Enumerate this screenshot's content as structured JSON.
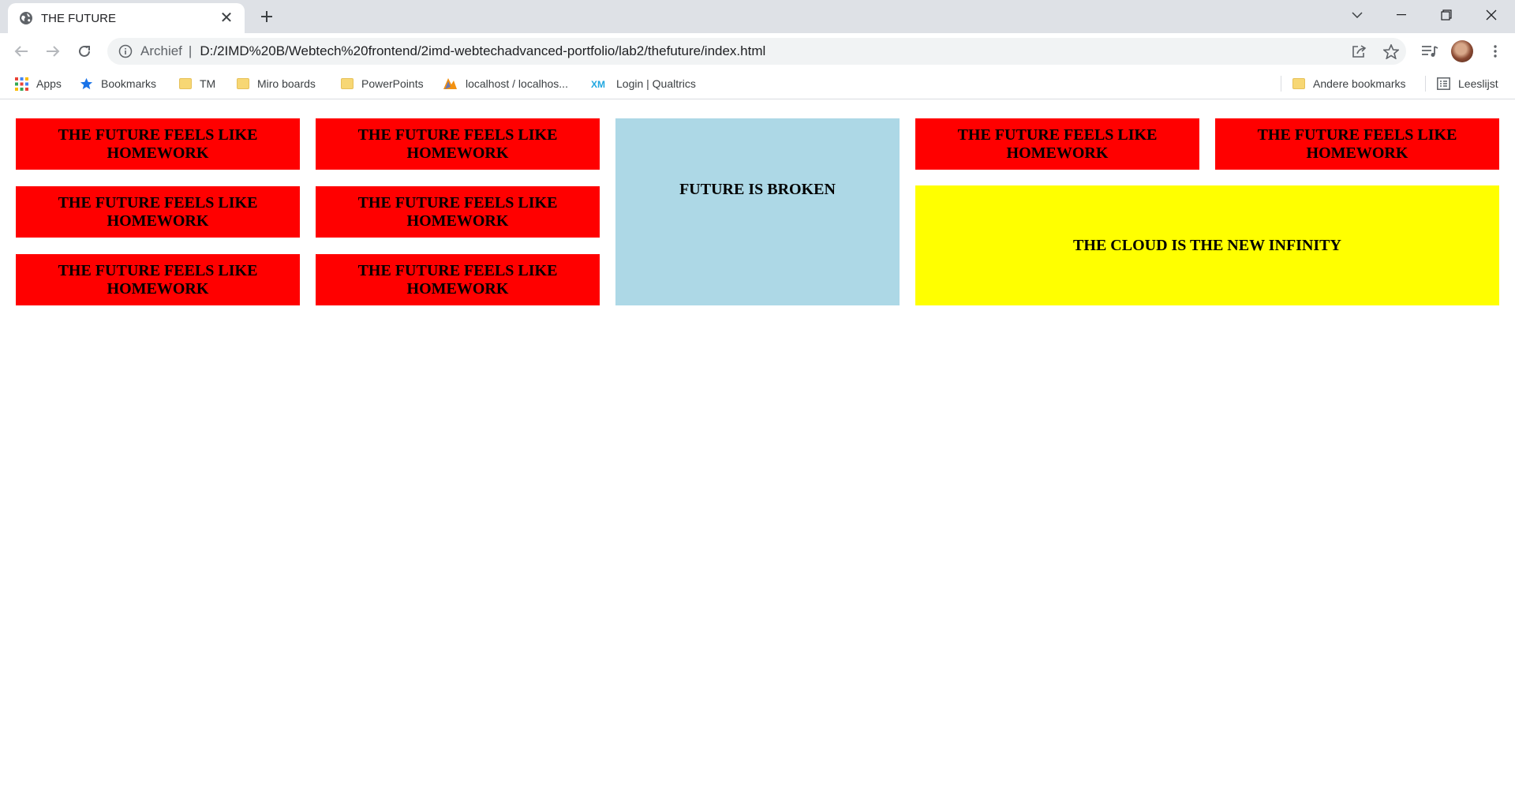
{
  "browser": {
    "tab": {
      "title": "THE FUTURE",
      "favicon": "globe-icon"
    },
    "address": {
      "security_label": "Archief",
      "separator": "|",
      "url": "D:/2IMD%20B/Webtech%20frontend/2imd-webtechadvanced-portfolio/lab2/thefuture/index.html"
    },
    "bookmarks": [
      {
        "label": "Apps",
        "icon": "apps-grid-icon"
      },
      {
        "label": "Bookmarks",
        "icon": "star-icon"
      },
      {
        "label": "TM",
        "icon": "folder-icon"
      },
      {
        "label": "Miro boards",
        "icon": "folder-icon"
      },
      {
        "label": "PowerPoints",
        "icon": "folder-icon"
      },
      {
        "label": "localhost / localhos...",
        "icon": "phpmyadmin-icon"
      },
      {
        "label": "Login | Qualtrics",
        "icon": "qualtrics-xm-icon"
      }
    ],
    "bookmarks_right": [
      {
        "label": "Andere bookmarks",
        "icon": "folder-icon"
      },
      {
        "label": "Leeslijst",
        "icon": "reading-list-icon"
      }
    ]
  },
  "page": {
    "homework_text": "THE FUTURE FEELS LIKE HOMEWORK",
    "broken_text": "FUTURE IS BROKEN",
    "cloud_text": "THE CLOUD IS THE NEW INFINITY",
    "colors": {
      "red": "#ff0000",
      "blue": "#add8e6",
      "yellow": "#ffff00"
    }
  }
}
